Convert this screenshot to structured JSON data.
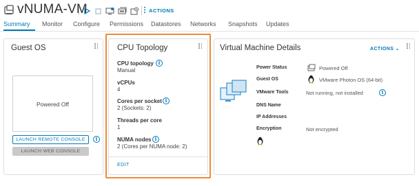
{
  "header": {
    "title": "vNUMA-VM",
    "actions_label": "ACTIONS",
    "toolbar_icons": [
      "power-on-icon",
      "power-off-icon",
      "console-icon",
      "migrate-icon",
      "settings-icon"
    ]
  },
  "tabs": [
    {
      "label": "Summary",
      "active": true
    },
    {
      "label": "Monitor",
      "active": false
    },
    {
      "label": "Configure",
      "active": false
    },
    {
      "label": "Permissions",
      "active": false
    },
    {
      "label": "Datastores",
      "active": false
    },
    {
      "label": "Networks",
      "active": false
    },
    {
      "label": "Snapshots",
      "active": false
    },
    {
      "label": "Updates",
      "active": false
    }
  ],
  "guest_os": {
    "title": "Guest OS",
    "preview_text": "Powered Off",
    "launch_remote_console": "LAUNCH REMOTE CONSOLE",
    "launch_web_console": "LAUNCH WEB CONSOLE"
  },
  "cpu_topology": {
    "title": "CPU Topology",
    "fields": [
      {
        "label": "CPU topology",
        "value": "Manual"
      },
      {
        "label": "vCPUs",
        "value": "4"
      },
      {
        "label": "Cores per socket",
        "value": "2 (Sockets: 2)"
      },
      {
        "label": "Threads per core",
        "value": "1"
      },
      {
        "label": "NUMA nodes",
        "value": "2 (Cores per NUMA node: 2)"
      }
    ],
    "edit_label": "EDIT",
    "highlight_color": "#ed8b37"
  },
  "vm_details": {
    "title": "Virtual Machine Details",
    "actions_label": "ACTIONS",
    "rows": [
      {
        "label": "Power Status",
        "value": "Powered Off"
      },
      {
        "label": "Guest OS",
        "value": "VMware Photon OS (64-bit)"
      },
      {
        "label": "VMware Tools",
        "value": "Not running, not installed"
      },
      {
        "label": "DNS Name",
        "value": ""
      },
      {
        "label": "IP Addresses",
        "value": ""
      },
      {
        "label": "Encryption",
        "value": "Not encrypted"
      }
    ]
  },
  "colors": {
    "accent": "#0079b8",
    "highlight": "#ed8b37",
    "border": "#dddddd"
  }
}
